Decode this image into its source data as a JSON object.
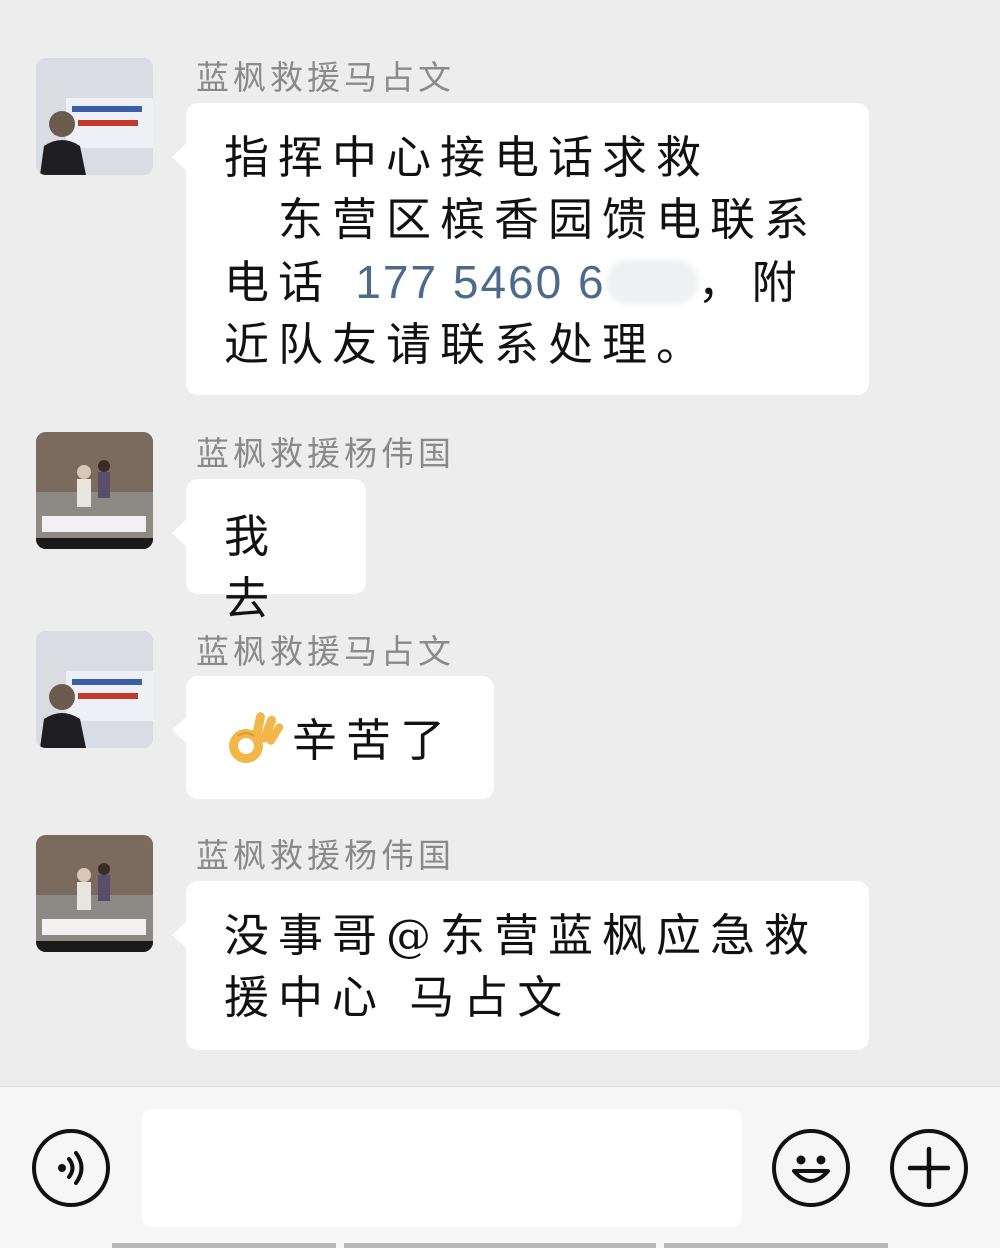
{
  "messages": [
    {
      "sender": "蓝枫救援马占文",
      "avatar_icon": "person-photo-avatar",
      "text_lines": [
        "指挥中心接电话求救",
        "　东营区槟香园馈电联系",
        "电话",
        "，附",
        "近队友请联系处理。"
      ],
      "phone": "177 5460 6"
    },
    {
      "sender": "蓝枫救援杨伟国",
      "avatar_icon": "road-photo-avatar",
      "text": "我去"
    },
    {
      "sender": "蓝枫救援马占文",
      "avatar_icon": "person-photo-avatar",
      "emoji": "ok-hand-emoji",
      "text": "辛苦了"
    },
    {
      "sender": "蓝枫救援杨伟国",
      "avatar_icon": "road-photo-avatar",
      "text_lines": [
        "没事哥@东营蓝枫应急救",
        "援中心 马占文"
      ]
    }
  ],
  "input_bar": {
    "voice_icon": "voice-icon",
    "emoji_icon": "emoji-smile-icon",
    "plus_icon": "plus-icon",
    "input_value": ""
  },
  "colors": {
    "background": "#ededed",
    "bubble": "#ffffff",
    "sender_name": "#8a8a8a",
    "phone_link": "#4d6a8c"
  }
}
